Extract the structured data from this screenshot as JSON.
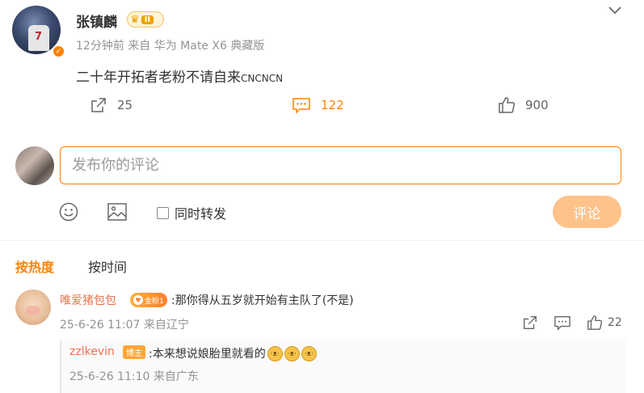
{
  "post": {
    "username": "张镇麟",
    "level_badge": "II",
    "meta": "12分钟前 来自 华为 Mate X6 典藏版",
    "jersey_number": "7",
    "text_main": "二十年开拓者老粉不请自来",
    "text_tail": "CNCNCN",
    "share_count": "25",
    "comment_count": "122",
    "like_count": "900"
  },
  "composer": {
    "placeholder": "发布你的评论",
    "repost_label": "同时转发",
    "submit_label": "评论"
  },
  "sort_tabs": {
    "hot": "按热度",
    "time": "按时间"
  },
  "comment": {
    "username": "唯爱猪包包",
    "fan_badge": "金粉1",
    "text": ":那你得从五岁就开始有主队了(不是)",
    "meta": "25-6-26 11:07 来自辽宁",
    "like_count": "22"
  },
  "reply": {
    "username": "zzlkevin",
    "badge": "博主",
    "text": ":本来想说娘胎里就看的",
    "meta": "25-6-26 11:10 来自广东"
  },
  "colors": {
    "accent": "#ff8200",
    "username_link": "#eb7350",
    "meta_gray": "#939393"
  }
}
